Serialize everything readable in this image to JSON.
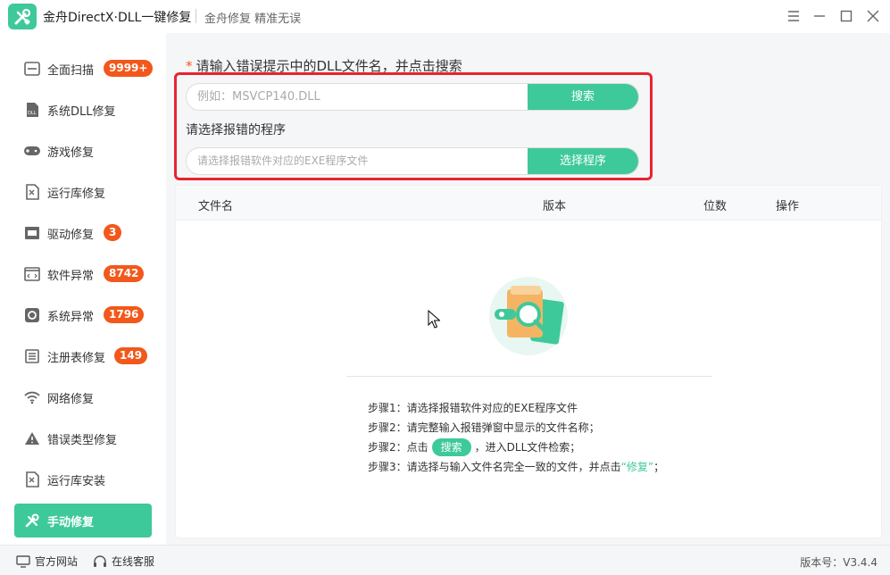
{
  "titlebar": {
    "app_title": "金舟DirectX·DLL一键修复",
    "subtitle": "金舟修复 精准无误"
  },
  "sidebar": {
    "items": [
      {
        "label": "全面扫描",
        "badge": "9999+",
        "icon": "scan-icon"
      },
      {
        "label": "系统DLL修复",
        "badge": "",
        "icon": "dll-file-icon"
      },
      {
        "label": "游戏修复",
        "badge": "",
        "icon": "gamepad-icon"
      },
      {
        "label": "运行库修复",
        "badge": "",
        "icon": "runtime-icon"
      },
      {
        "label": "驱动修复",
        "badge": "3",
        "icon": "driver-icon"
      },
      {
        "label": "软件异常",
        "badge": "8742",
        "icon": "code-window-icon"
      },
      {
        "label": "系统异常",
        "badge": "1796",
        "icon": "gear-icon"
      },
      {
        "label": "注册表修复",
        "badge": "149",
        "icon": "list-icon"
      },
      {
        "label": "网络修复",
        "badge": "",
        "icon": "wifi-icon"
      },
      {
        "label": "错误类型修复",
        "badge": "",
        "icon": "warning-icon"
      },
      {
        "label": "运行库安装",
        "badge": "",
        "icon": "runtime-install-icon"
      },
      {
        "label": "手动修复",
        "badge": "",
        "icon": "wrench-icon",
        "active": true
      }
    ]
  },
  "main": {
    "prompt": "请输入错误提示中的DLL文件名，并点击搜索",
    "prompt_star": "*",
    "search": {
      "placeholder": "例如：MSVCP140.DLL",
      "button": "搜索"
    },
    "program_label": "请选择报错的程序",
    "program": {
      "placeholder": "请选择报错软件对应的EXE程序文件",
      "button": "选择程序"
    },
    "table": {
      "headers": [
        "文件名",
        "版本",
        "位数",
        "操作"
      ]
    },
    "steps": {
      "s1": "步骤1：请选择报错软件对应的EXE程序文件",
      "s2": "步骤2：请完整输入报错弹窗中显示的文件名称；",
      "s3_pre": "步骤2：点击",
      "s3_pill": "搜索",
      "s3_post": "，进入DLL文件检索；",
      "s4_pre": "步骤3：请选择与输入文件名完全一致的文件，并点击",
      "s4_hl": "“修复”",
      "s4_post": "；"
    }
  },
  "bottombar": {
    "website": "官方网站",
    "support": "在线客服",
    "version": "版本号：V3.4.4"
  },
  "colors": {
    "accent": "#3ec99a",
    "badge": "#f2581b",
    "highlight_border": "#e8232f"
  }
}
